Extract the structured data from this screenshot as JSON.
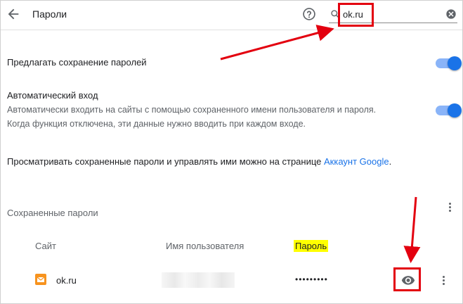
{
  "header": {
    "title": "Пароли",
    "search_value": "ok.ru"
  },
  "settings": {
    "offer_to_save": {
      "label": "Предлагать сохранение паролей",
      "enabled": true
    },
    "auto_signin": {
      "label": "Автоматический вход",
      "desc1": "Автоматически входить на сайты с помощью сохраненного имени пользователя и пароля.",
      "desc2": "Когда функция отключена, эти данные нужно вводить при каждом входе.",
      "enabled": true
    }
  },
  "manage_text": {
    "prefix": "Просматривать сохраненные пароли и управлять ими можно на странице ",
    "link": "Аккаунт Google",
    "suffix": "."
  },
  "saved_passwords": {
    "title": "Сохраненные пароли",
    "columns": {
      "site": "Сайт",
      "username": "Имя пользователя",
      "password": "Пароль"
    },
    "rows": [
      {
        "site": "ok.ru",
        "password": "•••••••••"
      }
    ]
  },
  "colors": {
    "accent": "#1a73e8",
    "annotation_red": "#e3000f",
    "highlight": "#ffff00",
    "favicon_orange": "#f7931e"
  },
  "icons": {
    "back": "arrow-left-icon",
    "help": "help-circle-icon",
    "search": "search-icon",
    "clear": "clear-circle-icon",
    "more": "more-vert-icon",
    "eye": "eye-icon",
    "favicon": "mail-envelope-icon"
  }
}
